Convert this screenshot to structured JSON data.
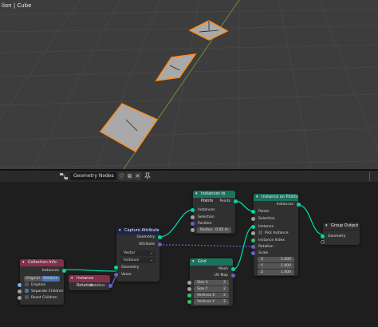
{
  "viewport": {
    "title": "lion | Cube"
  },
  "node_editor": {
    "header": {
      "tree_name": "Geometry Nodes",
      "fake_user_btn": "♡",
      "new_btn": "⧉",
      "close_btn": "✕",
      "pin_icon": "pin-icon"
    }
  },
  "nodes": {
    "collection_info": {
      "title": "Collection Info",
      "out_instances": "Instances",
      "original": "Original",
      "relative": "Relative",
      "empties": "Empties",
      "separate_children": "Separate Children",
      "reset_children": "Reset Children"
    },
    "instance_rotation": {
      "title": "Instance Rotation",
      "out_rotation": "Rotation"
    },
    "capture_attribute": {
      "title": "Capture Attribute",
      "out_geometry": "Geometry",
      "out_attribute": "Attribute",
      "type": "Vector",
      "domain": "Instance",
      "in_geometry": "Geometry",
      "in_value": "Value"
    },
    "instances_to_points": {
      "title": "Instances to Points",
      "out_points": "Points",
      "in_instances": "Instances",
      "in_selection": "Selection",
      "in_position": "Position",
      "radius_label": "Radius",
      "radius_value": "0.05 m"
    },
    "grid": {
      "title": "Grid",
      "out_mesh": "Mesh",
      "out_uvmap": "UV Map",
      "size_x_label": "Size X",
      "size_x": "2",
      "size_y_label": "Size Y",
      "size_y": "2",
      "vertices_x_label": "Vertices X",
      "vertices_x": "2",
      "vertices_y_label": "Vertices Y",
      "vertices_y": "2"
    },
    "instance_on_points": {
      "title": "Instance on Points",
      "out_instances": "Instances",
      "in_points": "Points",
      "in_selection": "Selection",
      "in_instance": "Instance",
      "pick_instance": "Pick Instance",
      "in_instance_index": "Instance Index",
      "in_rotation": "Rotation",
      "in_scale": "Scale",
      "x_label": "X",
      "x": "1.000",
      "y_label": "Y",
      "y": "1.000",
      "z_label": "Z",
      "z": "1.000"
    },
    "group_output": {
      "title": "Group Output",
      "in_geometry": "Geometry"
    }
  },
  "colors": {
    "geometry_header": "#1d725e",
    "input_header": "#83314a",
    "attribute_header": "#1d2546",
    "selection": "#ff8c1a"
  }
}
